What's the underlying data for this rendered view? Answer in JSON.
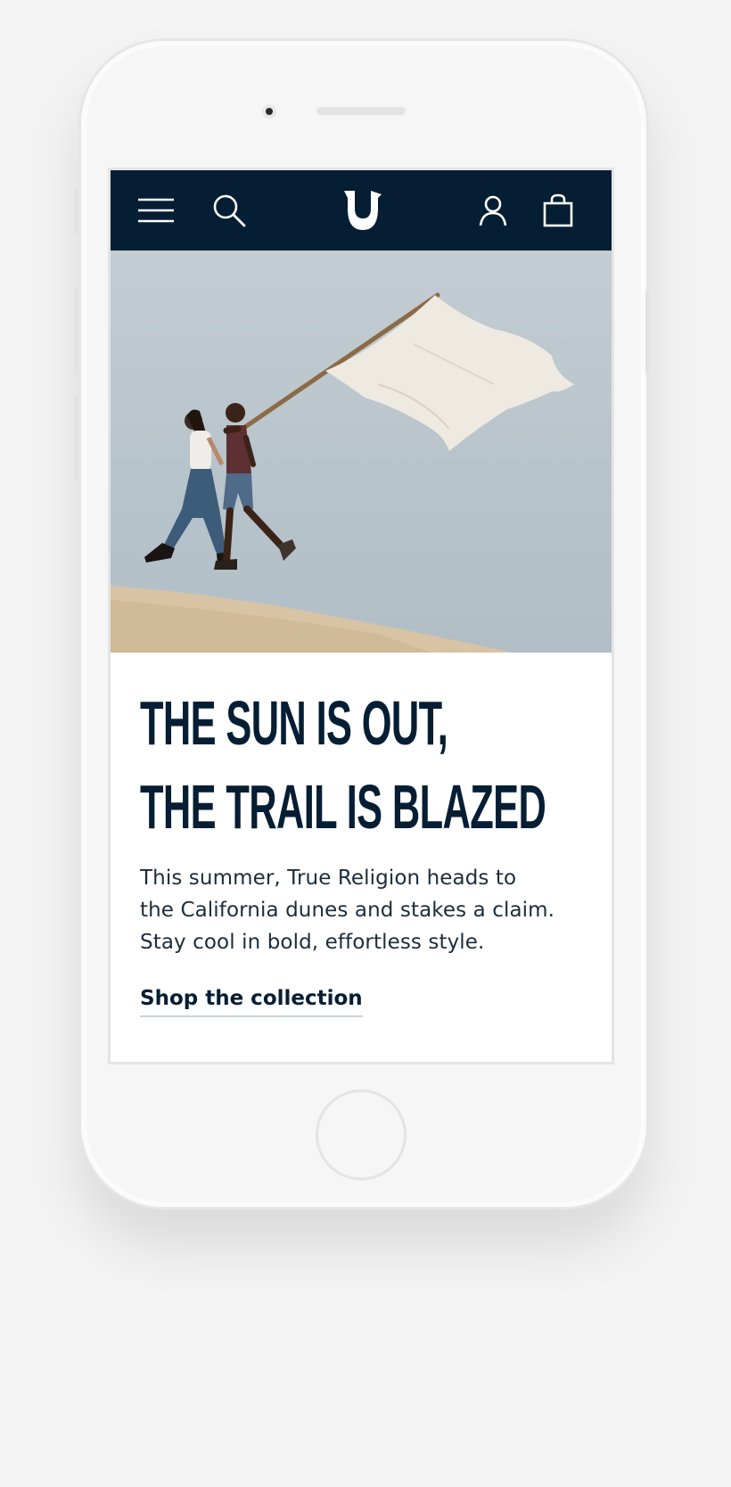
{
  "app": {
    "brand": "True Religion",
    "colors": {
      "navbar": "#061e33",
      "headline": "#061e33",
      "background": "#f3f3f3"
    }
  },
  "header": {
    "icons": [
      "hamburger-menu-icon",
      "search-icon",
      "horseshoe-logo",
      "user-icon",
      "shopping-bag-icon"
    ]
  },
  "hero": {
    "image": "couple walking on sand dune carrying large white flag against pale sky"
  },
  "content": {
    "headline_lines": [
      "THE SUN IS OUT,",
      "THE TRAIL IS BLAZED"
    ],
    "body_lines": [
      "This summer, True Religion heads to",
      "the California dunes and stakes a claim.",
      "Stay cool in bold, effortless style."
    ],
    "cta_label": "Shop the collection"
  }
}
